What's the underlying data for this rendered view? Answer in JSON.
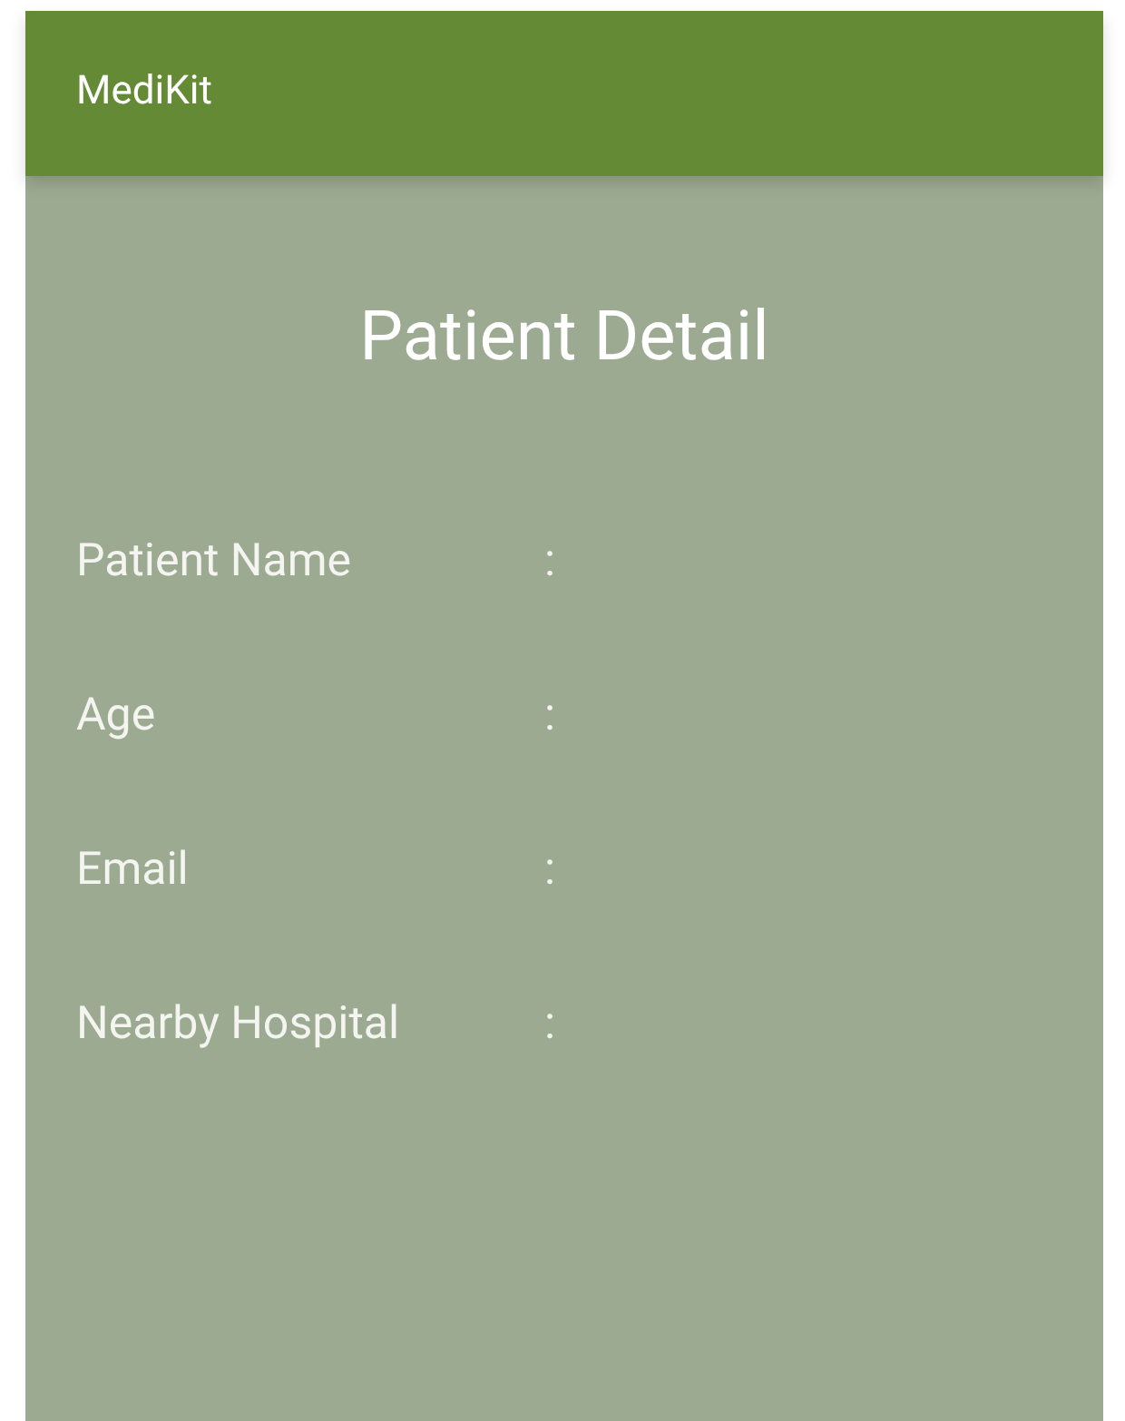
{
  "app_bar": {
    "title": "MediKit"
  },
  "heading": "Patient Detail",
  "fields": [
    {
      "label": "Patient Name",
      "separator": ":"
    },
    {
      "label": "Age",
      "separator": ":"
    },
    {
      "label": "Email",
      "separator": ":"
    },
    {
      "label": "Nearby Hospital",
      "separator": ":"
    }
  ]
}
